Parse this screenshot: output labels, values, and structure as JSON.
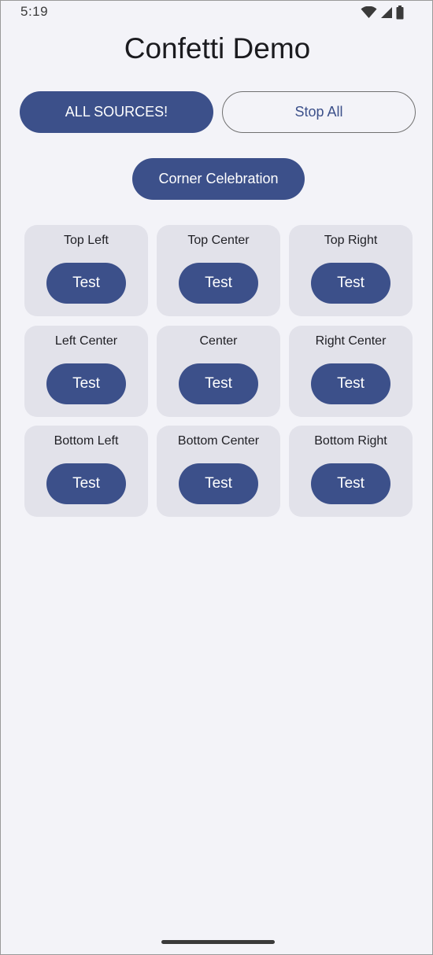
{
  "status_bar": {
    "time": "5:19"
  },
  "app": {
    "title": "Confetti Demo"
  },
  "actions": {
    "all_sources_label": "ALL SOURCES!",
    "stop_all_label": "Stop All",
    "corner_label": "Corner Celebration"
  },
  "grid": {
    "cards": [
      {
        "label": "Top Left",
        "button": "Test"
      },
      {
        "label": "Top Center",
        "button": "Test"
      },
      {
        "label": "Top Right",
        "button": "Test"
      },
      {
        "label": "Left Center",
        "button": "Test"
      },
      {
        "label": "Center",
        "button": "Test"
      },
      {
        "label": "Right Center",
        "button": "Test"
      },
      {
        "label": "Bottom Left",
        "button": "Test"
      },
      {
        "label": "Bottom Center",
        "button": "Test"
      },
      {
        "label": "Bottom Right",
        "button": "Test"
      }
    ]
  },
  "icons": {
    "wifi": "wifi-icon",
    "signal": "cellular-signal-icon",
    "battery": "battery-icon"
  },
  "colors": {
    "primary": "#3c508a",
    "card_bg": "#e2e2ea",
    "background": "#f3f3f8"
  }
}
